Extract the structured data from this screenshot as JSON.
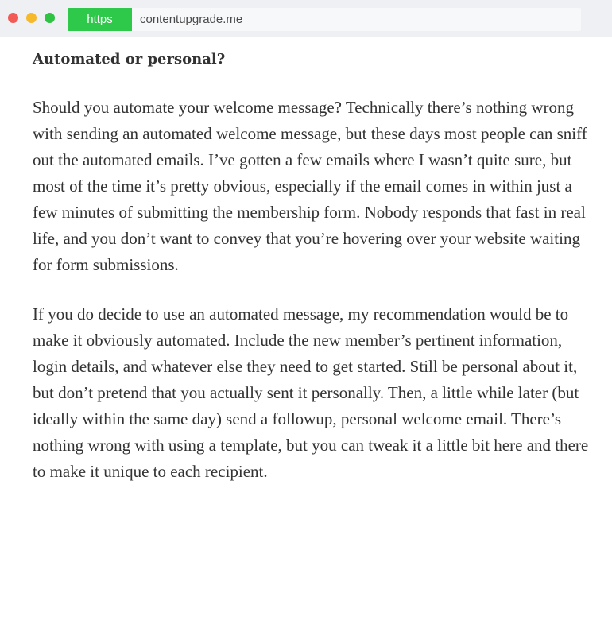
{
  "browser": {
    "protocol_badge": "https",
    "url": "contentupgrade.me"
  },
  "article": {
    "heading": "Automated or personal?",
    "paragraph1": "Should you automate your welcome message? Technically there’s nothing wrong with sending an automated welcome message, but these days most people can sniff out the automated emails. I’ve gotten a few emails where I wasn’t quite sure, but most of the time it’s pretty obvious, especially if the email comes in within just a few minutes of submitting the membership form. Nobody responds that fast in real life, and you don’t want to convey that you’re hovering over your website waiting for form submissions.",
    "paragraph2": "If you do decide to use an automated message, my recommendation would be to make it obviously automated. Include the new member’s pertinent information, login details, and whatever else they need to get started. Still be personal about it, but don’t pretend that you actually sent it personally. Then, a little while later (but ideally within the same day) send a followup, personal welcome email. There’s nothing wrong with using a template, but you can tweak it a little bit here and there to make it unique to each recipient."
  },
  "colors": {
    "https_badge": "#2ec84a",
    "traffic_close": "#f25a55",
    "traffic_minimize": "#f7b92c",
    "traffic_maximize": "#2fc344",
    "text": "#333333"
  }
}
